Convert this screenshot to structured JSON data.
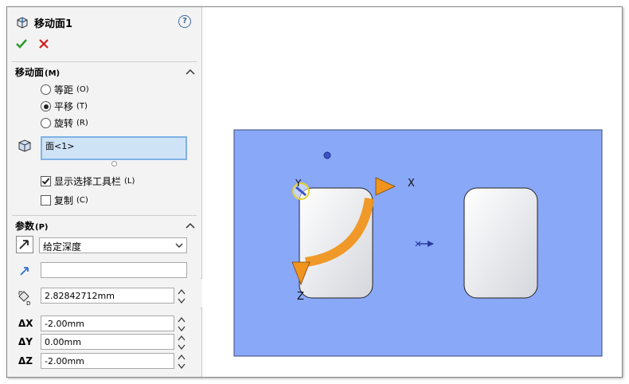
{
  "header": {
    "title": "移动面1",
    "help": "?"
  },
  "move_face": {
    "heading": "移动面",
    "key": "(M)",
    "options": [
      {
        "label": "等距",
        "key": "(O)",
        "selected": false
      },
      {
        "label": "平移",
        "key": "(T)",
        "selected": true
      },
      {
        "label": "旋转",
        "key": "(R)",
        "selected": false
      }
    ],
    "face_selection": "面<1>",
    "show_toolbar": {
      "label": "显示选择工具栏",
      "key": "(L)",
      "checked": true
    },
    "copy": {
      "label": "复制",
      "key": "(C)",
      "checked": false
    }
  },
  "params": {
    "heading": "参数",
    "key": "(P)",
    "end_condition": "给定深度",
    "direction_value": "",
    "distance": "2.82842712mm",
    "dx_label": "ΔX",
    "dx": "-2.00mm",
    "dy_label": "ΔY",
    "dy": "0.00mm",
    "dz_label": "ΔZ",
    "dz": "-2.00mm"
  },
  "viewport": {
    "axis_x": "X",
    "axis_y": "Y",
    "axis_z": "Z",
    "face_color": "#8aa8f8",
    "handle_color": "#f0941e"
  }
}
